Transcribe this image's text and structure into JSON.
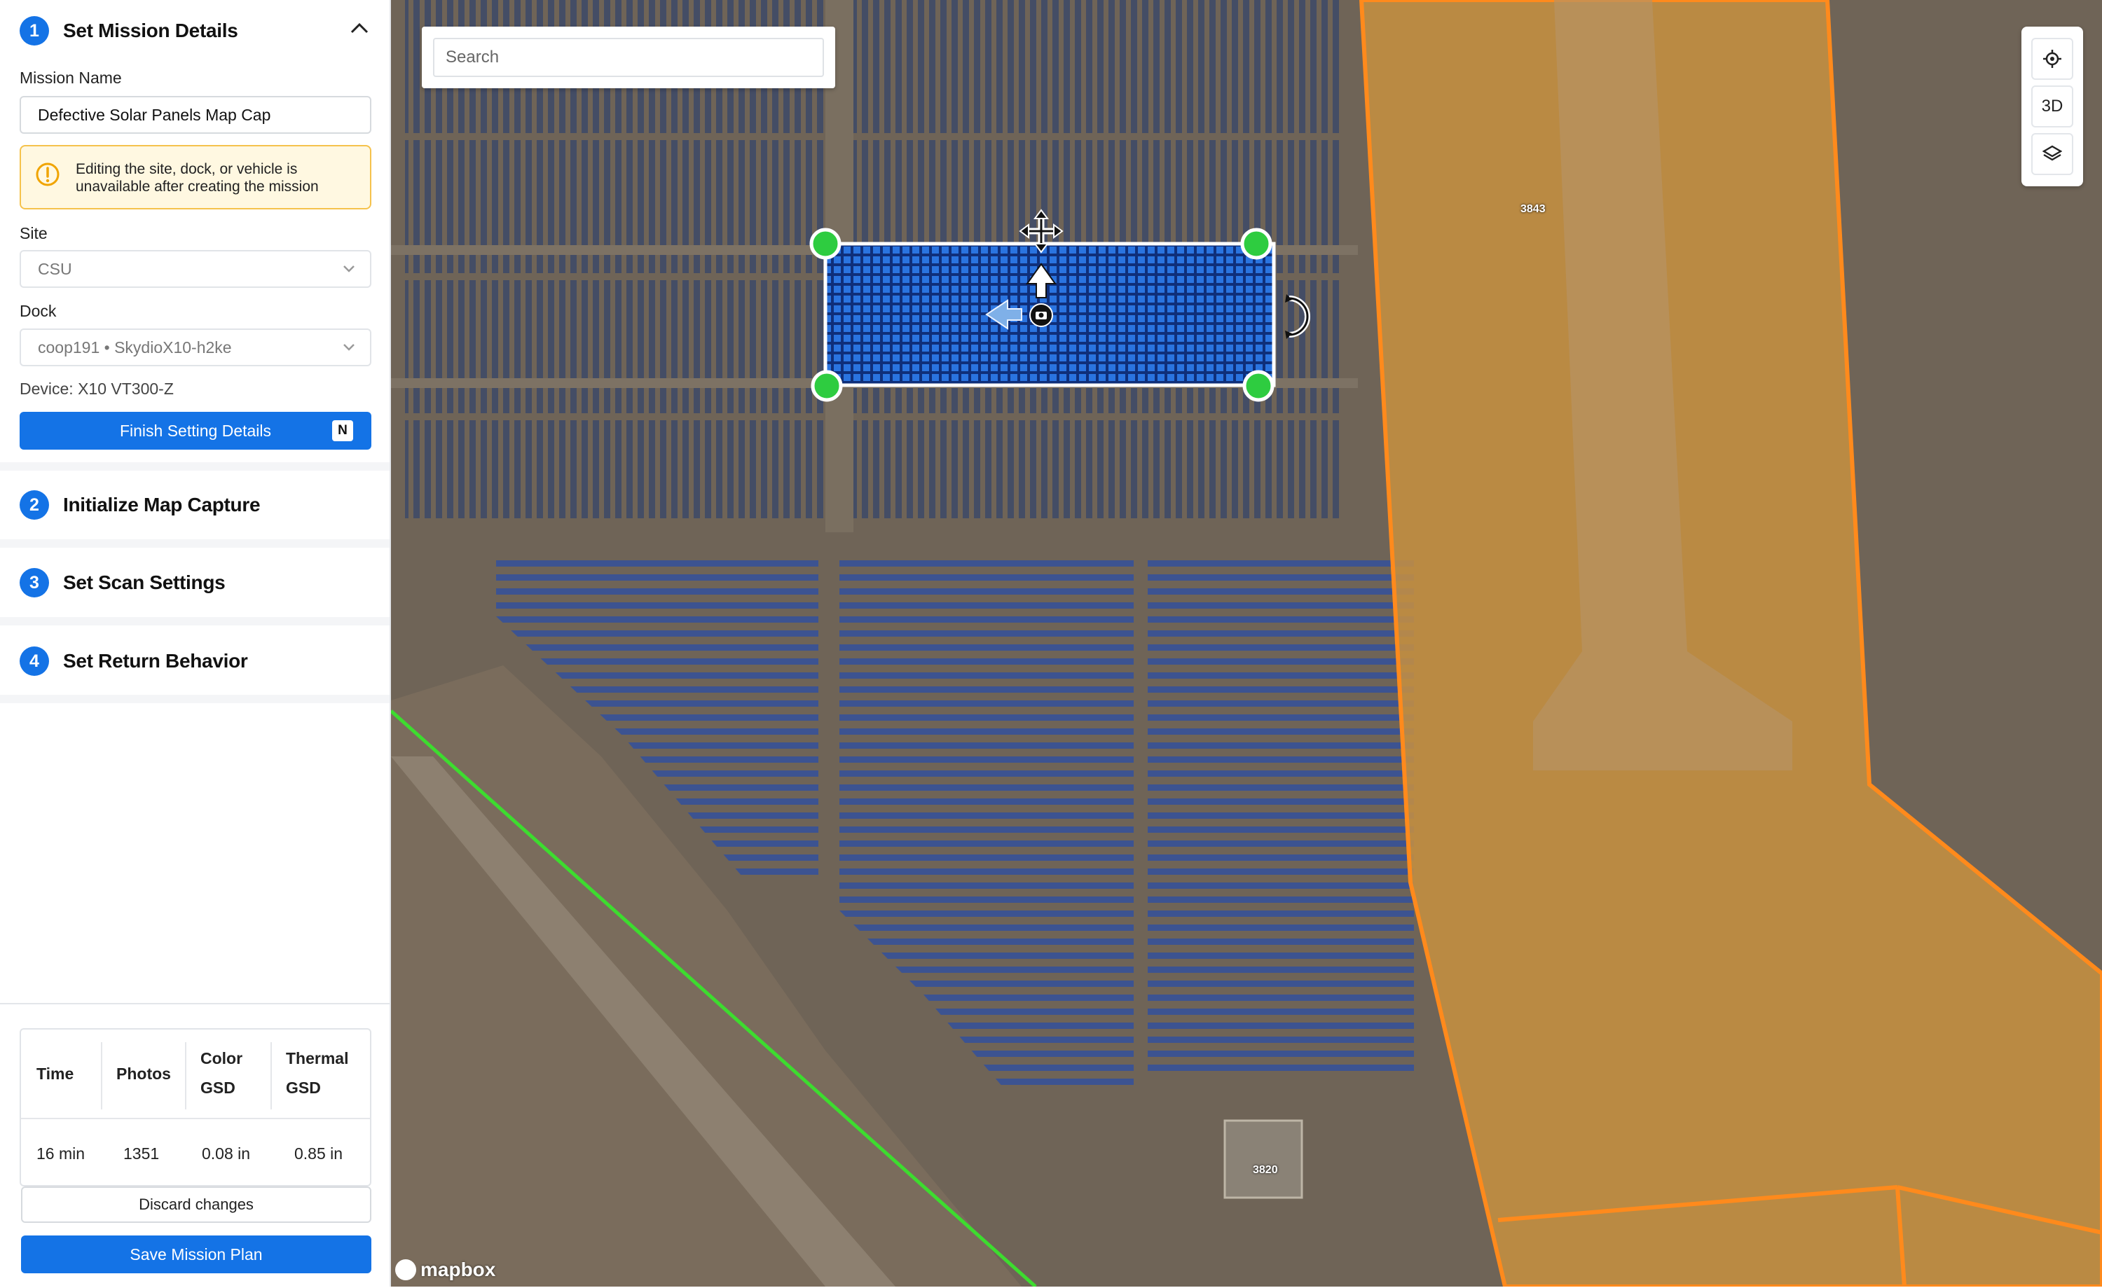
{
  "sidebar": {
    "steps": [
      {
        "number": "1",
        "title": "Set Mission Details"
      },
      {
        "number": "2",
        "title": "Initialize Map Capture"
      },
      {
        "number": "3",
        "title": "Set Scan Settings"
      },
      {
        "number": "4",
        "title": "Set Return Behavior"
      }
    ],
    "mission_name": {
      "label": "Mission Name",
      "value": "Defective Solar Panels Map Cap"
    },
    "warning": "Editing the site, dock, or vehicle is unavailable after creating the mission",
    "site": {
      "label": "Site",
      "value": "CSU"
    },
    "dock": {
      "label": "Dock",
      "value": "coop191 • SkydioX10-h2ke"
    },
    "device": "Device: X10 VT300-Z",
    "finish_button": {
      "label": "Finish Setting Details",
      "shortcut": "N"
    }
  },
  "summary": {
    "headers": {
      "time": "Time",
      "photos": "Photos",
      "color_gsd_1": "Color",
      "color_gsd_2": "GSD",
      "thermal_gsd_1": "Thermal",
      "thermal_gsd_2": "GSD"
    },
    "values": {
      "time": "16 min",
      "photos": "1351",
      "color_gsd": "0.08 in",
      "thermal_gsd": "0.85 in"
    },
    "discard_label": "Discard changes",
    "save_label": "Save Mission Plan"
  },
  "map": {
    "search_placeholder": "Search",
    "controls": {
      "locate_icon": "crosshair-icon",
      "three_d_label": "3D",
      "layers_icon": "layers-icon"
    },
    "building_labels": {
      "a": "3843",
      "b": "3820"
    },
    "attribution": "mapbox",
    "colors": {
      "zone_fill": "#c8913f",
      "zone_outline": "#ff8a1c",
      "boundary_line": "#3ddc2f",
      "selection_fill": "#1a5fd0",
      "handle": "#2ecc40"
    }
  }
}
